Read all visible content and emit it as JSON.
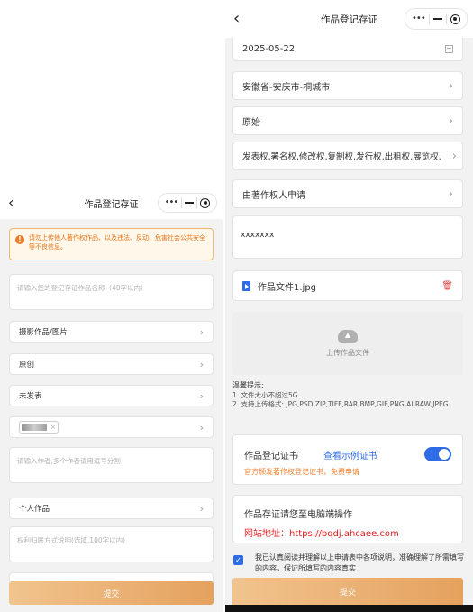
{
  "left_screen": {
    "title": "作品登记存证",
    "back_icon": "‹",
    "warning": "请勿上传他人著作权作品、以及违法、反动、危害社会公共安全等不良信息。",
    "name_placeholder": "请输入您的登记存证作品名称（40字以内）",
    "work_type": "摄影作品/图片",
    "creation_nature": "原创",
    "publish_status": "未发表",
    "author_placeholder": "请输入作者,多个作者请用逗号分割",
    "ownership": "个人作品",
    "rights_placeholder": "权利归属方式说明(选填,100字以内)",
    "submit": "提交"
  },
  "right_screen": {
    "title": "作品登记存证",
    "back_icon": "‹",
    "date": "2025-05-22",
    "location": "安徽省-安庆市-桐城市",
    "original": "原始",
    "rights": "发表权,署名权,修改权,复制权,发行权,出租权,展览权,",
    "applicant": "由著作权人申请",
    "description": "xxxxxxx",
    "file_name": "作品文件1.jpg",
    "upload_label": "上传作品文件",
    "tips_title": "温馨提示:",
    "tip1": "1. 文件大小不超过5G",
    "tip2": "2. 支持上传格式: JPG,PSD,ZIP,TIFF,RAR,BMP,GIF,PNG,AI,RAW,JPEG",
    "cert_title": "作品登记证书",
    "cert_link": "查看示例证书",
    "cert_sub": "官方颁发著作权登记证书，免费申请",
    "cert_toggle_on": true,
    "pc_notice": "作品存证请您至电脑端操作",
    "website": "网站地址：https://bqdj.ahcaee.com",
    "agreement": "我已认真阅读并理解以上申请表中各项说明，准确理解了所需填写的内容，保证所填写的内容真实",
    "submit": "提交"
  },
  "colors": {
    "accent_blue": "#2f6ce5",
    "warning_orange": "#f07b27",
    "url_red": "#e02020",
    "submit_gold": "#e5a15e"
  },
  "icons": [
    "back-icon",
    "more-dots-icon",
    "minimize-icon",
    "close-target-icon",
    "warning-icon",
    "chevron-right-icon",
    "calendar-icon",
    "file-icon",
    "trash-icon",
    "cloud-upload-icon",
    "checkbox-checked-icon"
  ]
}
